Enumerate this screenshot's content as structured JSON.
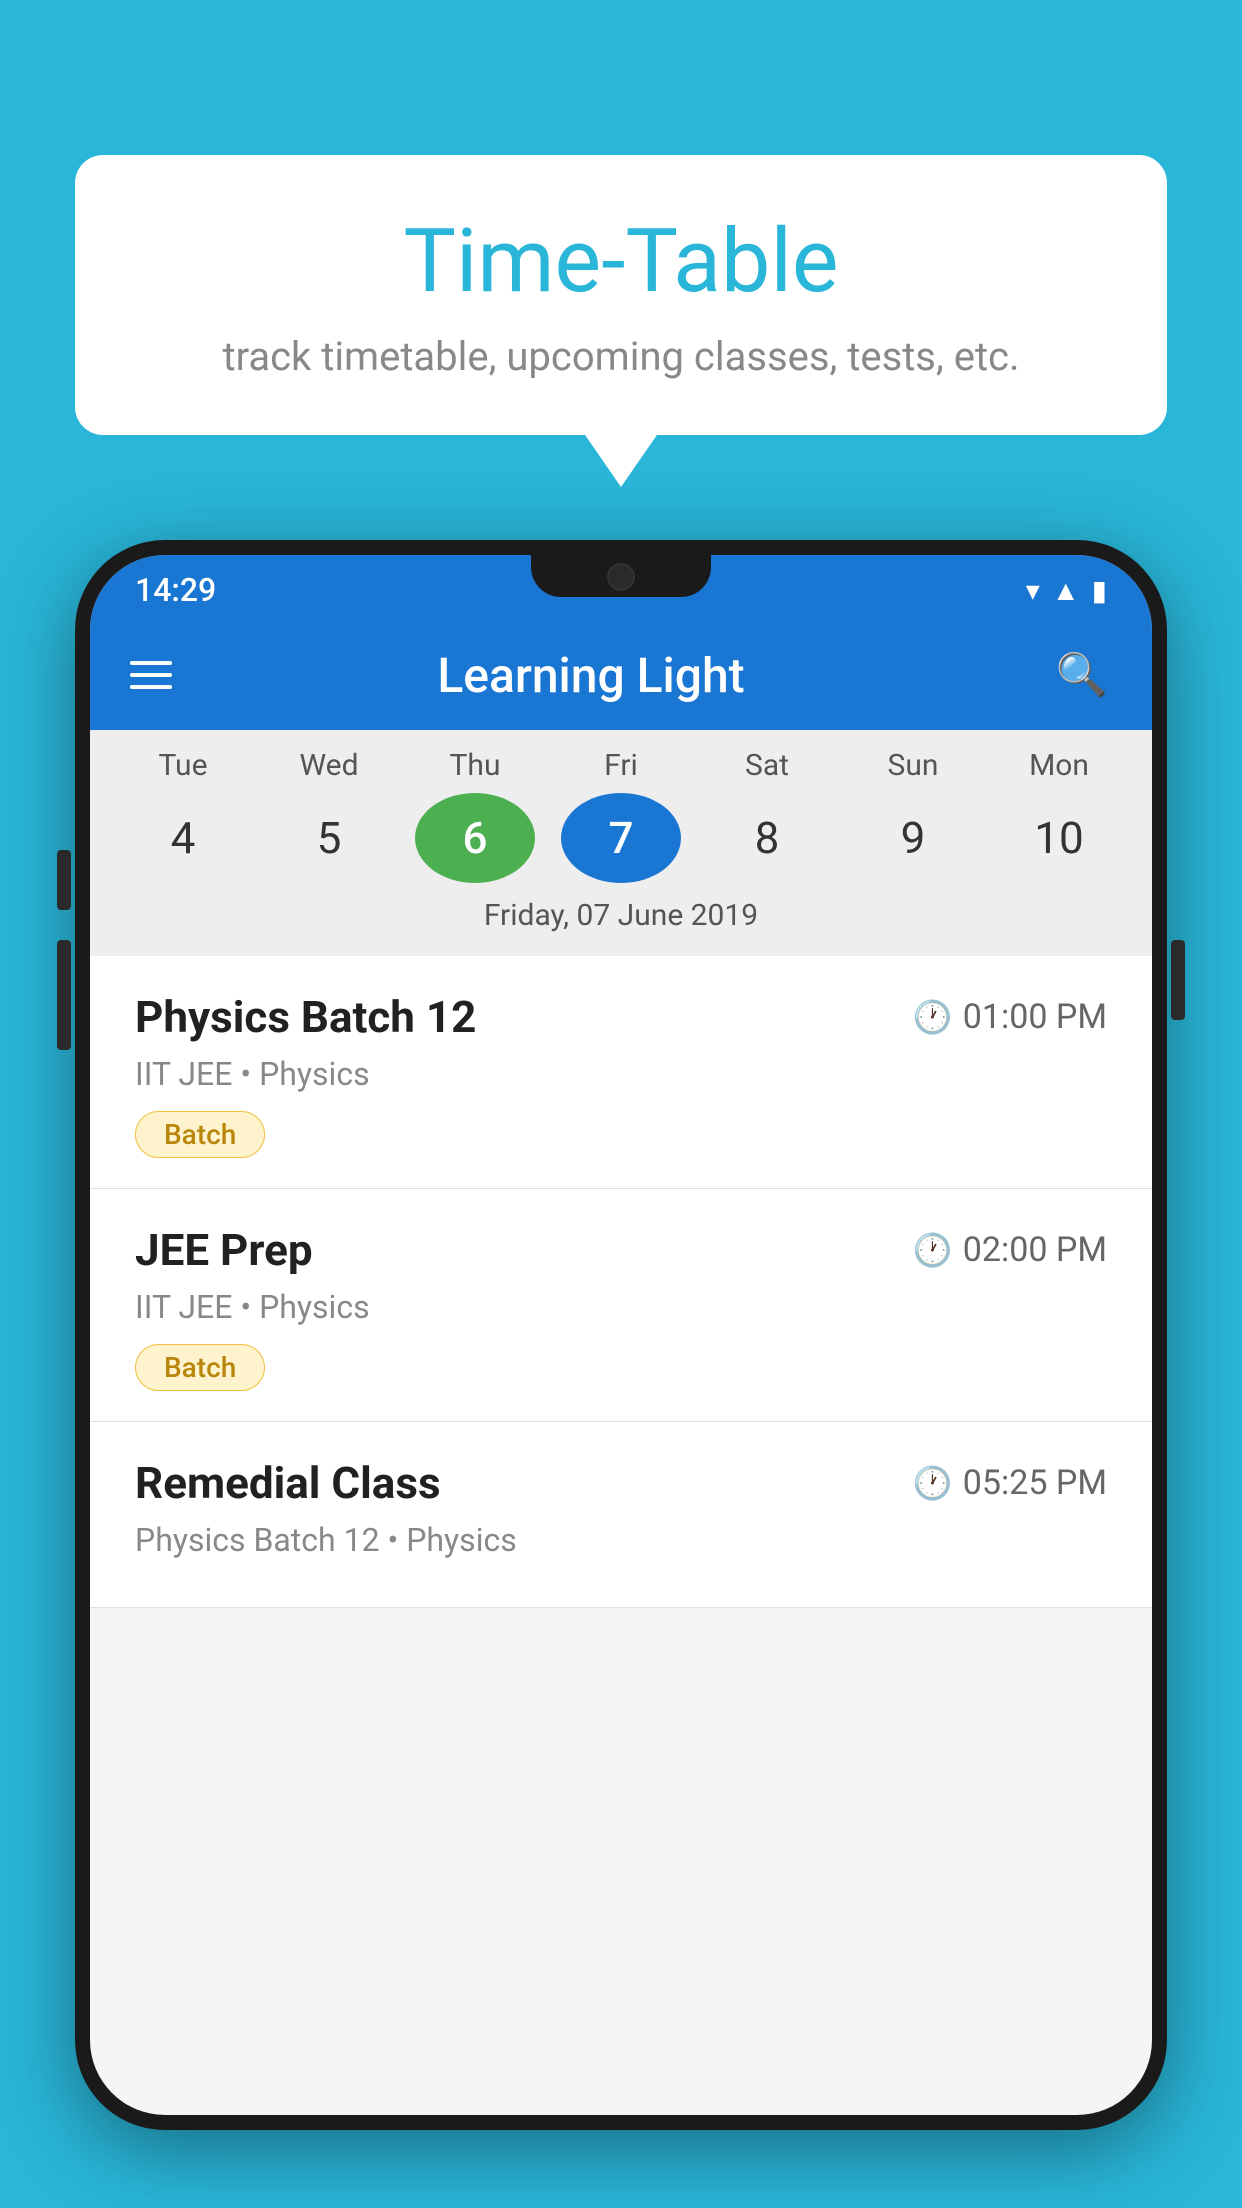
{
  "background_color": "#29b6d8",
  "speech_bubble": {
    "title": "Time-Table",
    "subtitle": "track timetable, upcoming classes, tests, etc."
  },
  "phone": {
    "status_bar": {
      "time": "14:29",
      "icons": [
        "wifi",
        "signal",
        "battery"
      ]
    },
    "app_bar": {
      "title": "Learning Light",
      "menu_icon": "hamburger",
      "search_icon": "search"
    },
    "calendar": {
      "days": [
        {
          "label": "Tue",
          "number": "4"
        },
        {
          "label": "Wed",
          "number": "5"
        },
        {
          "label": "Thu",
          "number": "6",
          "state": "today"
        },
        {
          "label": "Fri",
          "number": "7",
          "state": "selected"
        },
        {
          "label": "Sat",
          "number": "8"
        },
        {
          "label": "Sun",
          "number": "9"
        },
        {
          "label": "Mon",
          "number": "10"
        }
      ],
      "selected_date": "Friday, 07 June 2019"
    },
    "schedule": [
      {
        "title": "Physics Batch 12",
        "time": "01:00 PM",
        "subtitle": "IIT JEE • Physics",
        "tag": "Batch"
      },
      {
        "title": "JEE Prep",
        "time": "02:00 PM",
        "subtitle": "IIT JEE • Physics",
        "tag": "Batch"
      },
      {
        "title": "Remedial Class",
        "time": "05:25 PM",
        "subtitle": "Physics Batch 12 • Physics",
        "tag": null
      }
    ]
  }
}
